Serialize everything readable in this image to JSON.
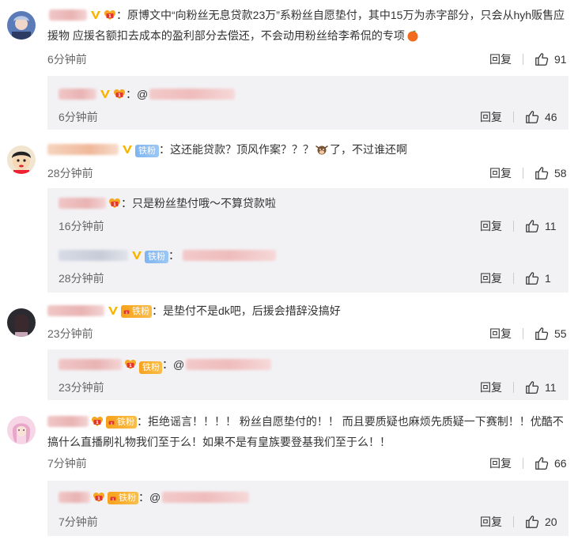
{
  "comments": [
    {
      "text_prefix": "：原博文中“向粉丝无息贷款23万”系粉丝自愿垫付，其中15万为赤字部分，只会从hyh贩售应援物 应援名额扣去成本的盈利部分去偿还，不会动用粉丝给李希侃的专项",
      "time": "6分钟前",
      "reply_label": "回复",
      "likes": "91",
      "replies": [
        {
          "text": "：@",
          "time": "6分钟前",
          "reply_label": "回复",
          "likes": "46"
        }
      ]
    },
    {
      "badge_label": "铁粉",
      "text_a": "：这还能贷款？顶风作案？？？",
      "text_b": "了，不过谁还啊",
      "time": "28分钟前",
      "reply_label": "回复",
      "likes": "58",
      "replies": [
        {
          "text": "：只是粉丝垫付哦～不算贷款啦",
          "time": "16分钟前",
          "reply_label": "回复",
          "likes": "11"
        },
        {
          "badge_label": "铁粉",
          "text": "：",
          "time": "28分钟前",
          "reply_label": "回复",
          "likes": "1"
        }
      ]
    },
    {
      "badge_label": "铁粉",
      "text": "：是垫付不是dk吧，后援会措辞没搞好",
      "time": "23分钟前",
      "reply_label": "回复",
      "likes": "55",
      "replies": [
        {
          "badge_label": "铁粉",
          "text": "：@",
          "time": "23分钟前",
          "reply_label": "回复",
          "likes": "11"
        }
      ]
    },
    {
      "badge_label": "铁粉",
      "text": "：拒绝谣言！！！！ 粉丝自愿垫付的！！ 而且要质疑也麻烦先质疑一下赛制！！优酷不搞什么直播刷礼物我们至于么！如果不是有皇族要登基我们至于么！！",
      "time": "7分钟前",
      "reply_label": "回复",
      "likes": "66",
      "replies": [
        {
          "badge_label": "铁粉",
          "text": "：@",
          "time": "7分钟前",
          "reply_label": "回复",
          "likes": "20"
        }
      ]
    }
  ]
}
